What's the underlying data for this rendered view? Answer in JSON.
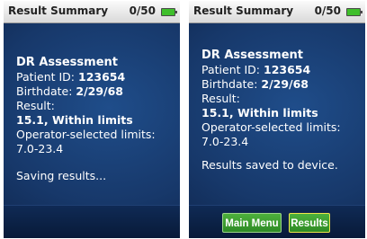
{
  "screens": [
    {
      "status_bar": {
        "title": "Result Summary",
        "count": "0/50"
      },
      "assessment": "DR Assessment",
      "patient_id_label": "Patient ID: ",
      "patient_id": "123654",
      "birthdate_label": "Birthdate: ",
      "birthdate": "2/29/68",
      "result_label": "Result:",
      "result_value": "15.1, Within limits",
      "limits_label": "Operator-selected limits:",
      "limits_value": "7.0-23.4",
      "status_message": "Saving results..."
    },
    {
      "status_bar": {
        "title": "Result Summary",
        "count": "0/50"
      },
      "assessment": "DR Assessment",
      "patient_id_label": "Patient ID: ",
      "patient_id": "123654",
      "birthdate_label": "Birthdate: ",
      "birthdate": "2/29/68",
      "result_label": "Result:",
      "result_value": "15.1, Within limits",
      "limits_label": "Operator-selected limits:",
      "limits_value": "7.0-23.4",
      "status_message": "Results saved to device.",
      "buttons": {
        "main_menu": "Main Menu",
        "results": "Results"
      }
    }
  ],
  "colors": {
    "button_green": "#3f9e32",
    "selected_border": "#f0e64a",
    "battery_green": "#3fbf2c",
    "screen_blue": "#17386a"
  }
}
